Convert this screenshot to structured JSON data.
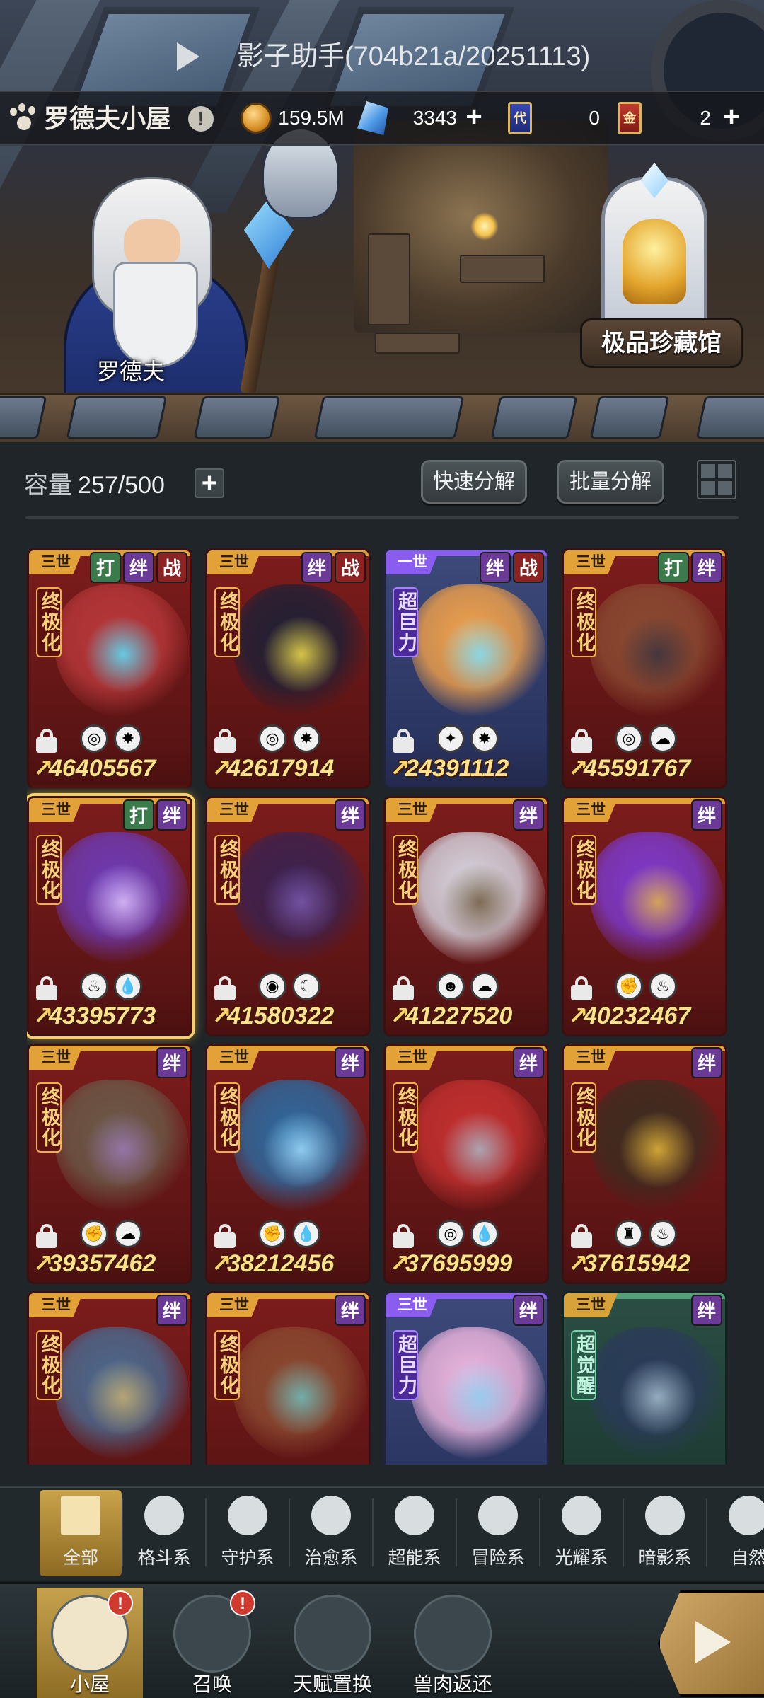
{
  "app_title": "影子助手(704b21a/20251113)",
  "cabin_name": "罗德夫小屋",
  "npc_name": "罗德夫",
  "gallery_label": "极品珍藏馆",
  "resources": {
    "coins": "159.5M",
    "crystals": "3343",
    "blue_ticket_label": "代",
    "blue_ticket": "0",
    "red_ticket_label": "金",
    "red_ticket": "2"
  },
  "storage": {
    "label": "容量",
    "value": "257/500",
    "quick_decompose": "快速分解",
    "batch_decompose": "批量分解"
  },
  "tag_labels": {
    "fight": "打",
    "bond": "绊",
    "war": "战"
  },
  "colors": {
    "gold": "#e3a238",
    "card_red": "#7d1c1c",
    "card_purple": "#3d4a7a",
    "card_green": "#2b4e44",
    "power_text": "#ffe18a"
  },
  "cards": [
    {
      "gen": "三世",
      "rank": "终极化",
      "tags": [
        "打",
        "绊",
        "战"
      ],
      "power": "46405567",
      "icons": [
        "shield-icon",
        "star-icon"
      ],
      "theme": "red"
    },
    {
      "gen": "三世",
      "rank": "终极化",
      "tags": [
        "绊",
        "战"
      ],
      "power": "42617914",
      "icons": [
        "shield-icon",
        "star-icon"
      ],
      "theme": "red"
    },
    {
      "gen": "一世",
      "rank": "超巨力",
      "tags": [
        "绊",
        "战"
      ],
      "power": "24391112",
      "icons": [
        "crosshair-icon",
        "star-icon"
      ],
      "theme": "purple"
    },
    {
      "gen": "三世",
      "rank": "终极化",
      "tags": [
        "打",
        "绊"
      ],
      "power": "45591767",
      "icons": [
        "shield-icon",
        "cloud-icon"
      ],
      "theme": "red"
    },
    {
      "gen": "三世",
      "rank": "终极化",
      "tags": [
        "打",
        "绊"
      ],
      "power": "43395773",
      "icons": [
        "flame-icon",
        "water-icon"
      ],
      "theme": "red",
      "selected": true
    },
    {
      "gen": "三世",
      "rank": "终极化",
      "tags": [
        "绊"
      ],
      "power": "41580322",
      "icons": [
        "eye-icon",
        "moon-icon"
      ],
      "theme": "red"
    },
    {
      "gen": "三世",
      "rank": "终极化",
      "tags": [
        "绊"
      ],
      "power": "41227520",
      "icons": [
        "alien-icon",
        "cloud-icon"
      ],
      "theme": "red"
    },
    {
      "gen": "三世",
      "rank": "终极化",
      "tags": [
        "绊"
      ],
      "power": "40232467",
      "icons": [
        "fist-icon",
        "fire-icon"
      ],
      "theme": "red"
    },
    {
      "gen": "三世",
      "rank": "终极化",
      "tags": [
        "绊"
      ],
      "power": "39357462",
      "icons": [
        "fist-icon",
        "cloud-icon"
      ],
      "theme": "red"
    },
    {
      "gen": "三世",
      "rank": "终极化",
      "tags": [
        "绊"
      ],
      "power": "38212456",
      "icons": [
        "fist-icon",
        "water-icon"
      ],
      "theme": "red"
    },
    {
      "gen": "三世",
      "rank": "终极化",
      "tags": [
        "绊"
      ],
      "power": "37695999",
      "icons": [
        "shield-icon",
        "water-icon"
      ],
      "theme": "red"
    },
    {
      "gen": "三世",
      "rank": "终极化",
      "tags": [
        "绊"
      ],
      "power": "37615942",
      "icons": [
        "tower-icon",
        "fire-icon"
      ],
      "theme": "red"
    },
    {
      "gen": "三世",
      "rank": "终极化",
      "tags": [
        "绊"
      ],
      "power": "",
      "icons": [],
      "theme": "red"
    },
    {
      "gen": "三世",
      "rank": "终极化",
      "tags": [
        "绊"
      ],
      "power": "",
      "icons": [],
      "theme": "red"
    },
    {
      "gen": "三世",
      "rank": "超巨力",
      "tags": [
        "绊"
      ],
      "power": "",
      "icons": [],
      "theme": "purple"
    },
    {
      "gen": "三世",
      "rank": "超觉醒",
      "tags": [
        "绊"
      ],
      "power": "",
      "icons": [],
      "theme": "green"
    }
  ],
  "filters": [
    {
      "label": "全部",
      "icon": "all-blocks-icon",
      "active": true
    },
    {
      "label": "格斗系",
      "icon": "fist-icon"
    },
    {
      "label": "守护系",
      "icon": "shield-icon"
    },
    {
      "label": "治愈系",
      "icon": "sprout-icon"
    },
    {
      "label": "超能系",
      "icon": "alien-icon"
    },
    {
      "label": "冒险系",
      "icon": "tower-icon"
    },
    {
      "label": "光耀系",
      "icon": "crosshair-icon"
    },
    {
      "label": "暗影系",
      "icon": "eye-icon"
    },
    {
      "label": "自然",
      "icon": "leaf-icon"
    }
  ],
  "nav": [
    {
      "label": "小屋",
      "icon": "house-icon",
      "active": true,
      "badge": "!"
    },
    {
      "label": "召唤",
      "icon": "egg-icon",
      "badge": "!"
    },
    {
      "label": "天赋置换",
      "icon": "swap-icon"
    },
    {
      "label": "兽肉返还",
      "icon": "meat-icon"
    }
  ]
}
